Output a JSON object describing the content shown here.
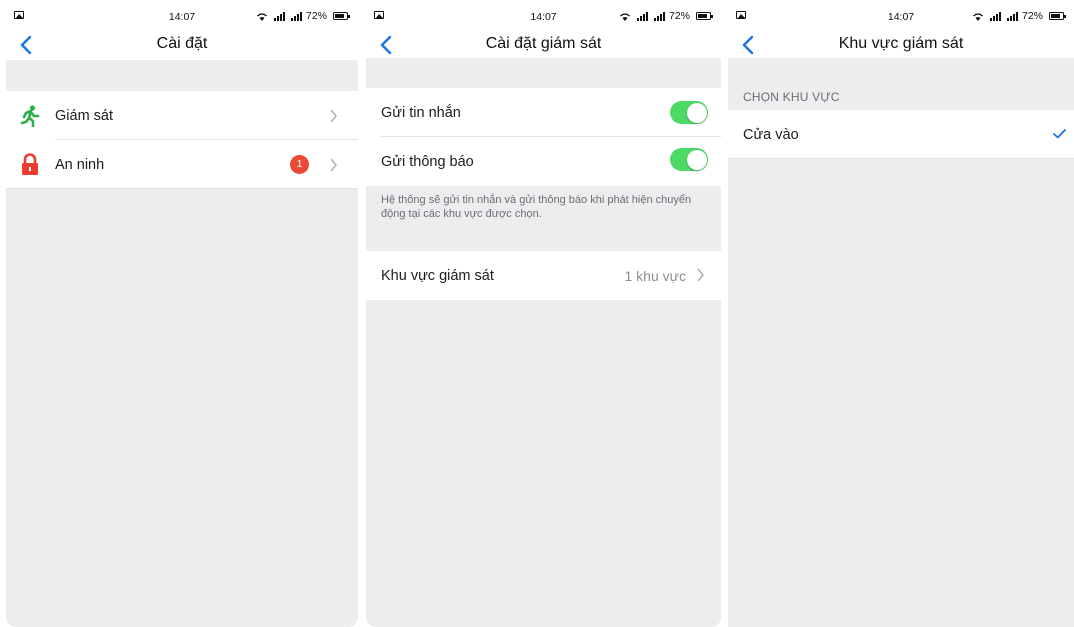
{
  "status_bar": {
    "time": "14:07",
    "battery": "72%"
  },
  "screens": [
    {
      "title": "Cài đặt",
      "items": [
        {
          "label": "Giám sát",
          "icon": "running-person-icon",
          "icon_color": "#2bb14a"
        },
        {
          "label": "An ninh",
          "icon": "lock-icon",
          "icon_color": "#ec3b2f",
          "badge": "1"
        }
      ]
    },
    {
      "title": "Cài đặt giám sát",
      "toggles": [
        {
          "label": "Gửi tin nhắn",
          "on": true
        },
        {
          "label": "Gửi thông báo",
          "on": true
        }
      ],
      "note": "Hệ thống sẽ gửi tin nhắn và gửi thông báo khi phát hiện chuyển động tại các khu vực được chọn.",
      "area_row": {
        "label": "Khu vực giám sát",
        "value": "1 khu vực"
      }
    },
    {
      "title": "Khu vực giám sát",
      "section_header": "CHỌN KHU VỰC",
      "options": [
        {
          "label": "Cửa vào",
          "selected": true
        }
      ]
    }
  ],
  "colors": {
    "accent_blue": "#1a73e8",
    "toggle_on": "#4cd964",
    "badge_red": "#ec4a35",
    "background": "#ededf0"
  }
}
